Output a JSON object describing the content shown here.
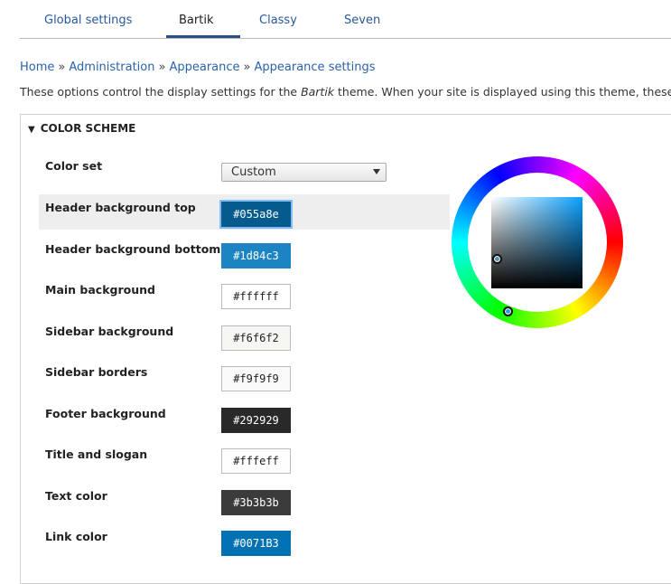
{
  "tabs": [
    {
      "label": "Global settings",
      "active": false
    },
    {
      "label": "Bartik",
      "active": true
    },
    {
      "label": "Classy",
      "active": false
    },
    {
      "label": "Seven",
      "active": false
    }
  ],
  "breadcrumb": {
    "items": [
      "Home",
      "Administration",
      "Appearance",
      "Appearance settings"
    ],
    "separator": "»"
  },
  "description": {
    "before": "These options control the display settings for the ",
    "theme": "Bartik",
    "after": " theme. When your site is displayed using this theme, these"
  },
  "fieldset": {
    "legend": "COLOR SCHEME",
    "color_set": {
      "label": "Color set",
      "value": "Custom"
    },
    "fields": [
      {
        "label": "Header background top",
        "value": "#055a8e",
        "bg": "#055a8e",
        "fg": "#ffffff",
        "focused": true
      },
      {
        "label": "Header background bottom",
        "value": "#1d84c3",
        "bg": "#1d84c3",
        "fg": "#ffffff",
        "focused": false
      },
      {
        "label": "Main background",
        "value": "#ffffff",
        "bg": "#ffffff",
        "fg": "#222222",
        "focused": false
      },
      {
        "label": "Sidebar background",
        "value": "#f6f6f2",
        "bg": "#f6f6f2",
        "fg": "#222222",
        "focused": false
      },
      {
        "label": "Sidebar borders",
        "value": "#f9f9f9",
        "bg": "#f9f9f9",
        "fg": "#222222",
        "focused": false
      },
      {
        "label": "Footer background",
        "value": "#292929",
        "bg": "#292929",
        "fg": "#ffffff",
        "focused": false
      },
      {
        "label": "Title and slogan",
        "value": "#fffeff",
        "bg": "#fffeff",
        "fg": "#222222",
        "focused": false
      },
      {
        "label": "Text color",
        "value": "#3b3b3b",
        "bg": "#3b3b3b",
        "fg": "#ffffff",
        "focused": false
      },
      {
        "label": "Link color",
        "value": "#0071B3",
        "bg": "#0071B3",
        "fg": "#ffffff",
        "focused": false
      }
    ]
  },
  "colors": {
    "accent": "#27579b",
    "tab_underline": "#2a4f88",
    "highlight_row": "#eeeeee"
  }
}
